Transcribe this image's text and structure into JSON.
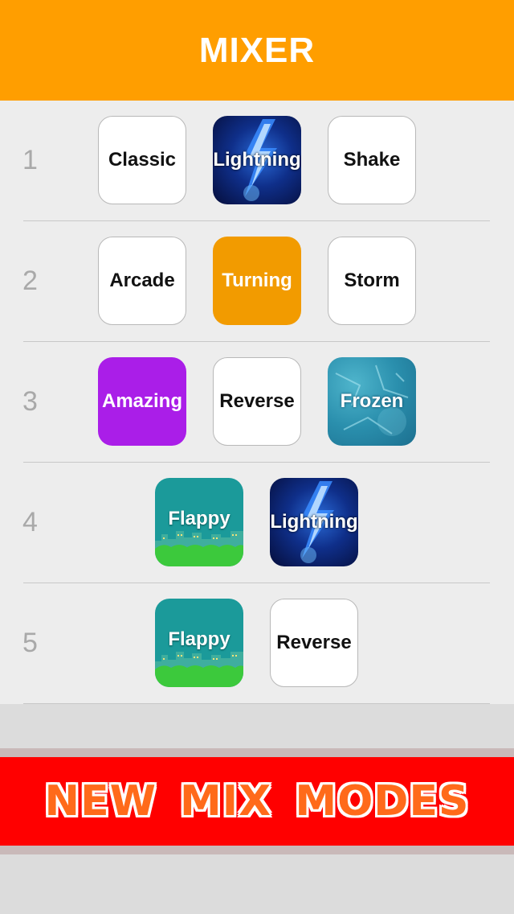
{
  "colors": {
    "header_bg": "#ff9e00",
    "banner_bg": "#ff0000",
    "banner_text": "#ff6a1a",
    "turning_bg": "#f29b00",
    "amazing_bg": "#aa1ee8"
  },
  "header": {
    "title": "MIXER"
  },
  "rows": [
    {
      "number": "1",
      "tiles": [
        {
          "label": "Classic",
          "style": "white"
        },
        {
          "label": "Lightning",
          "style": "lightning"
        },
        {
          "label": "Shake",
          "style": "white"
        }
      ]
    },
    {
      "number": "2",
      "tiles": [
        {
          "label": "Arcade",
          "style": "white"
        },
        {
          "label": "Turning",
          "style": "orange"
        },
        {
          "label": "Storm",
          "style": "white"
        }
      ]
    },
    {
      "number": "3",
      "tiles": [
        {
          "label": "Amazing",
          "style": "purple"
        },
        {
          "label": "Reverse",
          "style": "white"
        },
        {
          "label": "Frozen",
          "style": "frozen"
        }
      ]
    },
    {
      "number": "4",
      "tiles": [
        {
          "label": "Flappy",
          "style": "flappy"
        },
        {
          "label": "Lightning",
          "style": "lightning"
        }
      ]
    },
    {
      "number": "5",
      "tiles": [
        {
          "label": "Flappy",
          "style": "flappy"
        },
        {
          "label": "Reverse",
          "style": "white"
        }
      ]
    }
  ],
  "banner": {
    "text": "NEW MIX MODES"
  }
}
